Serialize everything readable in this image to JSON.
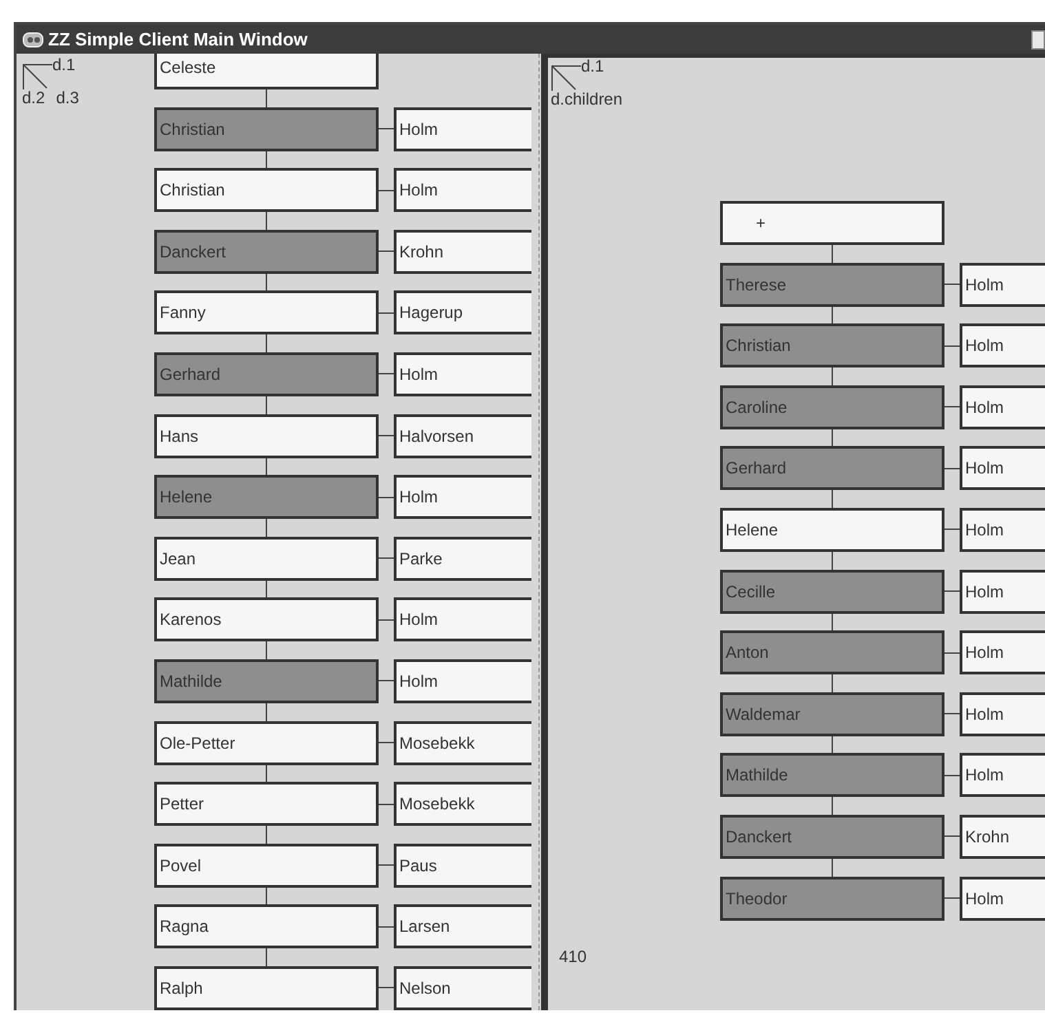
{
  "window": {
    "title": "ZZ Simple Client Main Window"
  },
  "left_panel": {
    "legend": {
      "axis_x": "d.1",
      "axis_y": "d.2",
      "axis_diag": "d.3"
    },
    "rows": [
      {
        "name": "Celeste",
        "surname": "",
        "selected": false
      },
      {
        "name": "Christian",
        "surname": "Holm",
        "selected": true
      },
      {
        "name": "Christian",
        "surname": "Holm",
        "selected": false
      },
      {
        "name": "Danckert",
        "surname": "Krohn",
        "selected": true
      },
      {
        "name": "Fanny",
        "surname": "Hagerup",
        "selected": false
      },
      {
        "name": "Gerhard",
        "surname": "Holm",
        "selected": true
      },
      {
        "name": "Hans",
        "surname": "Halvorsen",
        "selected": false
      },
      {
        "name": "Helene",
        "surname": "Holm",
        "selected": true
      },
      {
        "name": "Jean",
        "surname": "Parke",
        "selected": false
      },
      {
        "name": "Karenos",
        "surname": "Holm",
        "selected": false
      },
      {
        "name": "Mathilde",
        "surname": "Holm",
        "selected": true
      },
      {
        "name": "Ole-Petter",
        "surname": "Mosebekk",
        "selected": false
      },
      {
        "name": "Petter",
        "surname": "Mosebekk",
        "selected": false
      },
      {
        "name": "Povel",
        "surname": "Paus",
        "selected": false
      },
      {
        "name": "Ragna",
        "surname": "Larsen",
        "selected": false
      },
      {
        "name": "Ralph",
        "surname": "Nelson",
        "selected": false
      }
    ]
  },
  "right_panel": {
    "legend": {
      "axis_x": "d.1",
      "axis_y": "d.children"
    },
    "head": "+",
    "rows": [
      {
        "name": "Therese",
        "surname": "Holm",
        "selected": true
      },
      {
        "name": "Christian",
        "surname": "Holm",
        "selected": true
      },
      {
        "name": "Caroline",
        "surname": "Holm",
        "selected": true
      },
      {
        "name": "Gerhard",
        "surname": "Holm",
        "selected": true
      },
      {
        "name": "Helene",
        "surname": "Holm",
        "selected": false
      },
      {
        "name": "Cecille",
        "surname": "Holm",
        "selected": true
      },
      {
        "name": "Anton",
        "surname": "Holm",
        "selected": true
      },
      {
        "name": "Waldemar",
        "surname": "Holm",
        "selected": true
      },
      {
        "name": "Mathilde",
        "surname": "Holm",
        "selected": true
      },
      {
        "name": "Danckert",
        "surname": "Krohn",
        "selected": true
      },
      {
        "name": "Theodor",
        "surname": "Holm",
        "selected": true
      }
    ],
    "counter": "410"
  }
}
